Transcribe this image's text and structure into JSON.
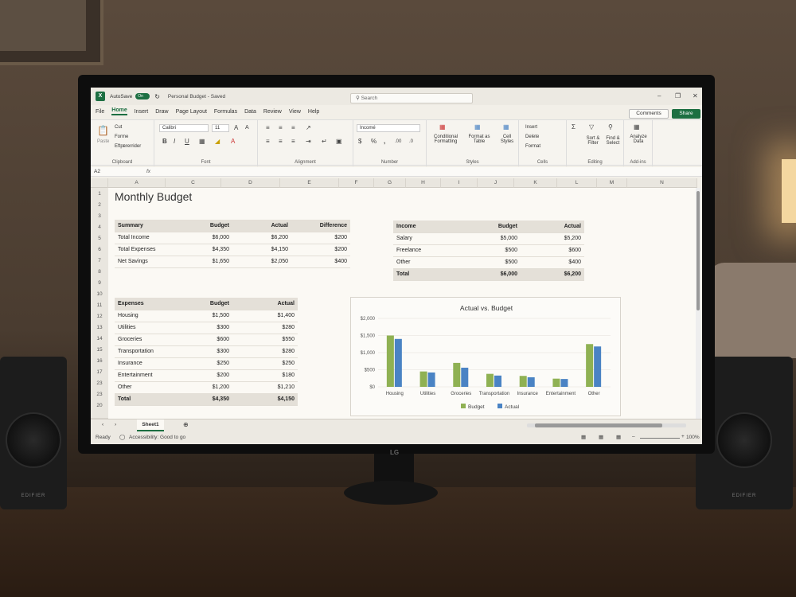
{
  "window": {
    "autosave_label": "AutoSave",
    "autosave_state": "On",
    "doc_title": "Personal Budget - Saved",
    "search_placeholder": "Search",
    "comments_label": "Comments",
    "share_label": "Share"
  },
  "menu": [
    "File",
    "Home",
    "Insert",
    "Draw",
    "Page Layout",
    "Formulas",
    "Data",
    "Review",
    "View",
    "Help"
  ],
  "ribbon": {
    "clipboard": {
      "paste": "Paste",
      "cut": "Cut",
      "format": "Forme",
      "painter": "Eftpвrerrider",
      "label": "Clipboard"
    },
    "font": {
      "name": "Calibri",
      "size": "11",
      "label": "Font"
    },
    "alignment": {
      "label": "Alignment"
    },
    "number": {
      "format": "Incomé",
      "label": "Number"
    },
    "styles": {
      "cond": "Conditional Formatting",
      "table": "Format as Table",
      "cell": "Cell Styles",
      "label": "Styles"
    },
    "cells": {
      "insert": "Insert",
      "delete": "Delete",
      "format": "Format",
      "label": "Cells"
    },
    "editing": {
      "sort": "Sort & Filter",
      "find": "Find & Select",
      "label": "Editing"
    },
    "addins": {
      "analyze": "Analyze Data",
      "label": "Add-ins"
    }
  },
  "formula_bar": {
    "namebox": "A2",
    "fx": "fx"
  },
  "columns": [
    "A",
    "C",
    "D",
    "E",
    "F",
    "G",
    "H",
    "I",
    "J",
    "K",
    "L",
    "M",
    "N"
  ],
  "rows": [
    "1",
    "2",
    "3",
    "4",
    "5",
    "6",
    "7",
    "8",
    "9",
    "10",
    "11",
    "12",
    "13",
    "14",
    "15",
    "16",
    "17",
    "23",
    "23",
    "20"
  ],
  "sheet_title": "Monthly Budget",
  "summary": {
    "headers": [
      "Summary",
      "Budget",
      "Actual",
      "Difference"
    ],
    "rows": [
      [
        "Total Income",
        "$6,000",
        "$6,200",
        "$200"
      ],
      [
        "Total Expenses",
        "$4,350",
        "$4,150",
        "$200"
      ],
      [
        "Net Savings",
        "$1,650",
        "$2,050",
        "$400"
      ]
    ]
  },
  "income": {
    "headers": [
      "Income",
      "Budget",
      "Actual"
    ],
    "rows": [
      [
        "Salary",
        "$5,000",
        "$5,200"
      ],
      [
        "Freelance",
        "$500",
        "$600"
      ],
      [
        "Other",
        "$500",
        "$400"
      ]
    ],
    "total": [
      "Total",
      "$6,000",
      "$6,200"
    ]
  },
  "expenses": {
    "headers": [
      "Expenses",
      "Budget",
      "Actual"
    ],
    "rows": [
      [
        "Housing",
        "$1,500",
        "$1,400"
      ],
      [
        "Utilities",
        "$300",
        "$280"
      ],
      [
        "Groceries",
        "$600",
        "$550"
      ],
      [
        "Transportation",
        "$300",
        "$280"
      ],
      [
        "Insurance",
        "$250",
        "$250"
      ],
      [
        "Entertainment",
        "$200",
        "$180"
      ],
      [
        "Other",
        "$1,200",
        "$1,210"
      ]
    ],
    "total": [
      "Total",
      "$4,350",
      "$4,150"
    ]
  },
  "chart_data": {
    "type": "bar",
    "title": "Actual vs. Budget",
    "categories": [
      "Housing",
      "Utilities",
      "Groceries",
      "Transportation",
      "Insurance",
      "Entertainment",
      "Other"
    ],
    "series": [
      {
        "name": "Budget",
        "values": [
          1500,
          450,
          700,
          380,
          320,
          240,
          1250
        ],
        "color": "#8fb153"
      },
      {
        "name": "Actual",
        "values": [
          1400,
          420,
          560,
          330,
          280,
          230,
          1180
        ],
        "color": "#4a83c4"
      }
    ],
    "yticks": [
      "$0",
      "$500",
      "$1,000",
      "$1,500",
      "$2,000"
    ],
    "ylim": [
      0,
      2000
    ],
    "legend": "bottom"
  },
  "sheet_tab": "Sheet1",
  "status": {
    "ready": "Ready",
    "accessibility": "Accessibility: Good to go",
    "zoom": "100%"
  },
  "monitor_brand": "LG",
  "speaker_brand_left": "EDIFIER",
  "speaker_brand_right": "EDIFIER"
}
